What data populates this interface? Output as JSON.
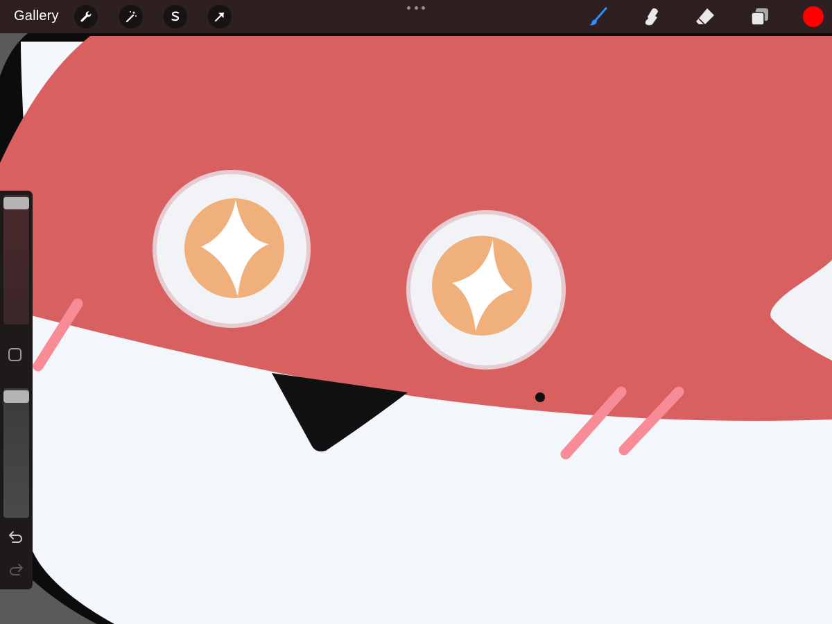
{
  "toolbar": {
    "gallery_label": "Gallery",
    "left_tools": [
      {
        "icon": "wrench-icon",
        "name": "actions-button"
      },
      {
        "icon": "magic-wand-icon",
        "name": "adjustments-button"
      },
      {
        "icon": "selection-s-icon",
        "name": "selection-button"
      },
      {
        "icon": "arrow-cursor-icon",
        "name": "transform-button"
      }
    ],
    "right_tools": [
      {
        "icon": "brush-icon",
        "name": "paint-button",
        "active": true
      },
      {
        "icon": "smudge-icon",
        "name": "smudge-button",
        "active": false
      },
      {
        "icon": "eraser-icon",
        "name": "eraser-button",
        "active": false
      },
      {
        "icon": "layers-icon",
        "name": "layers-button",
        "active": false
      }
    ],
    "current_color": "#ff0000",
    "active_tool_color": "#2f8cff"
  },
  "sidebar": {
    "brush_size_level": 1.0,
    "opacity_level": 1.0,
    "undo_icon": "undo-icon",
    "redo_icon": "redo-icon",
    "modify_icon": "square-icon"
  },
  "artwork_colors": {
    "head": "#d96060",
    "belly": "#f3f6fa",
    "outline": "#0c0c0c",
    "eye_white": "#f1f3f7",
    "eye_rim": "#e6cbd0",
    "iris": "#f0b07c",
    "sparkle": "#ffffff",
    "blush": "#f78b96",
    "beak": "#111111"
  }
}
